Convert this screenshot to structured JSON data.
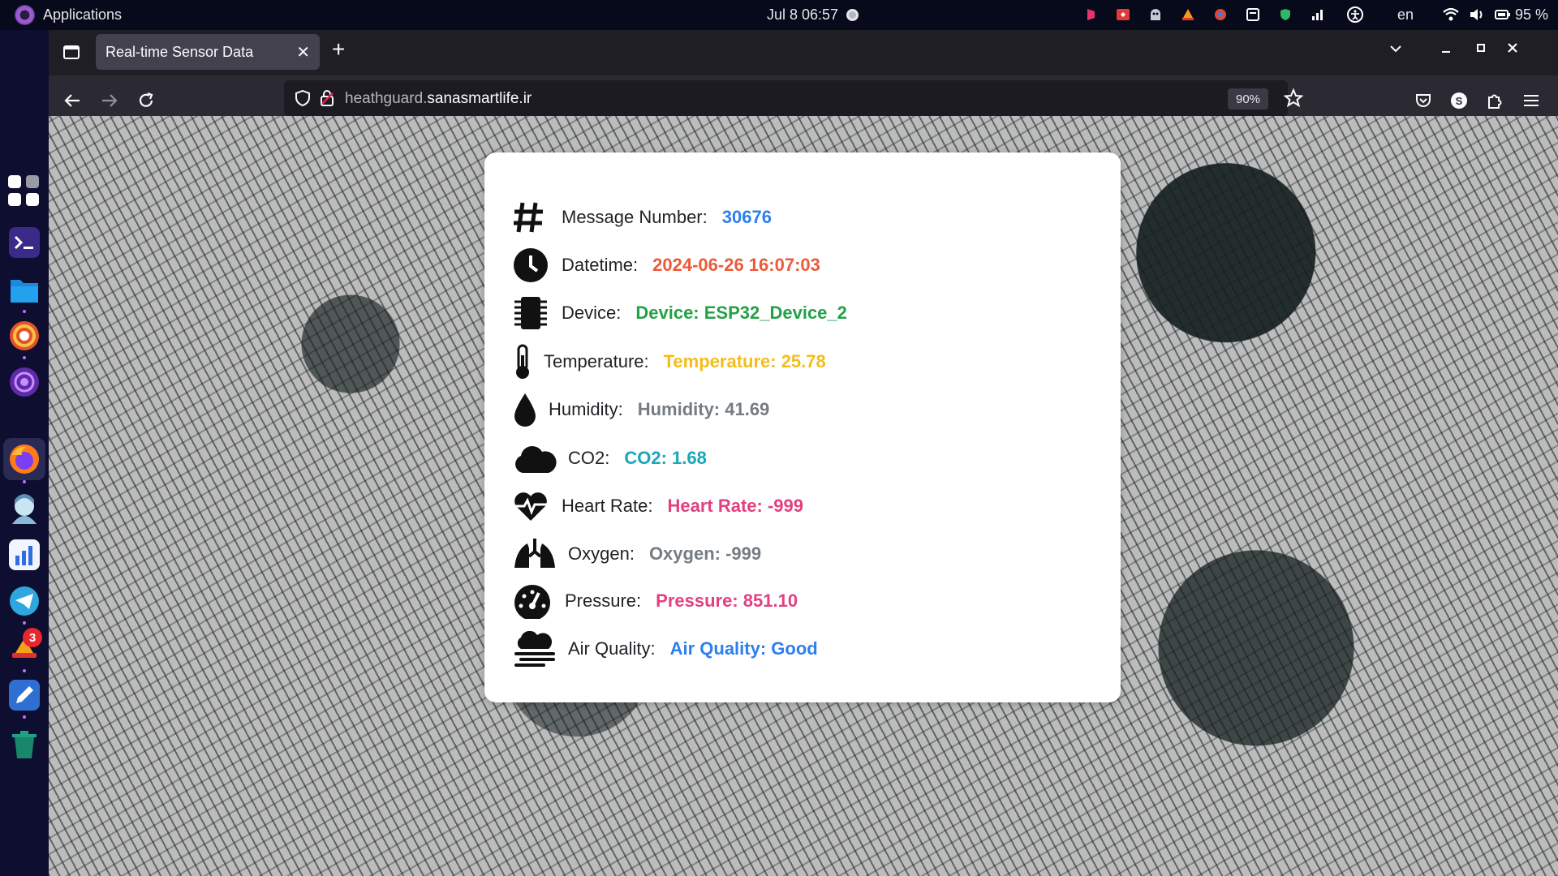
{
  "topbar": {
    "apps_label": "Applications",
    "clock": "Jul 8  06:57",
    "language": "en",
    "battery": "95 %"
  },
  "browser": {
    "tab": {
      "title": "Real-time Sensor Data"
    },
    "url": {
      "host_prefix": "heathguard.",
      "host_main": "sanasmartlife.ir"
    },
    "zoom": "90%"
  },
  "dock": {
    "badge_count": "3"
  },
  "sensor": {
    "rows": [
      {
        "icon": "hashtag-icon",
        "label": "Message Number:",
        "value": "30676",
        "color": "#2d7ff0"
      },
      {
        "icon": "clock-icon",
        "label": "Datetime:",
        "value": "2024-06-26 16:07:03",
        "color": "#ec5a3a"
      },
      {
        "icon": "microchip-icon",
        "label": "Device:",
        "value": "Device: ESP32_Device_2",
        "color": "#23a245"
      },
      {
        "icon": "thermometer-icon",
        "label": "Temperature:",
        "value": "Temperature: 25.78",
        "color": "#f4bd1c"
      },
      {
        "icon": "droplet-icon",
        "label": "Humidity:",
        "value": "Humidity: 41.69",
        "color": "#757c82"
      },
      {
        "icon": "cloud-icon",
        "label": "CO2:",
        "value": "CO2: 1.68",
        "color": "#1aa6b8"
      },
      {
        "icon": "heart-pulse-icon",
        "label": "Heart Rate:",
        "value": "Heart Rate: -999",
        "color": "#e2407f"
      },
      {
        "icon": "lungs-icon",
        "label": "Oxygen:",
        "value": "Oxygen: -999",
        "color": "#757c82"
      },
      {
        "icon": "gauge-icon",
        "label": "Pressure:",
        "value": "Pressure: 851.10",
        "color": "#e2407f"
      },
      {
        "icon": "smog-icon",
        "label": "Air Quality:",
        "value": "Air Quality: Good",
        "color": "#2d7ff0"
      }
    ]
  }
}
